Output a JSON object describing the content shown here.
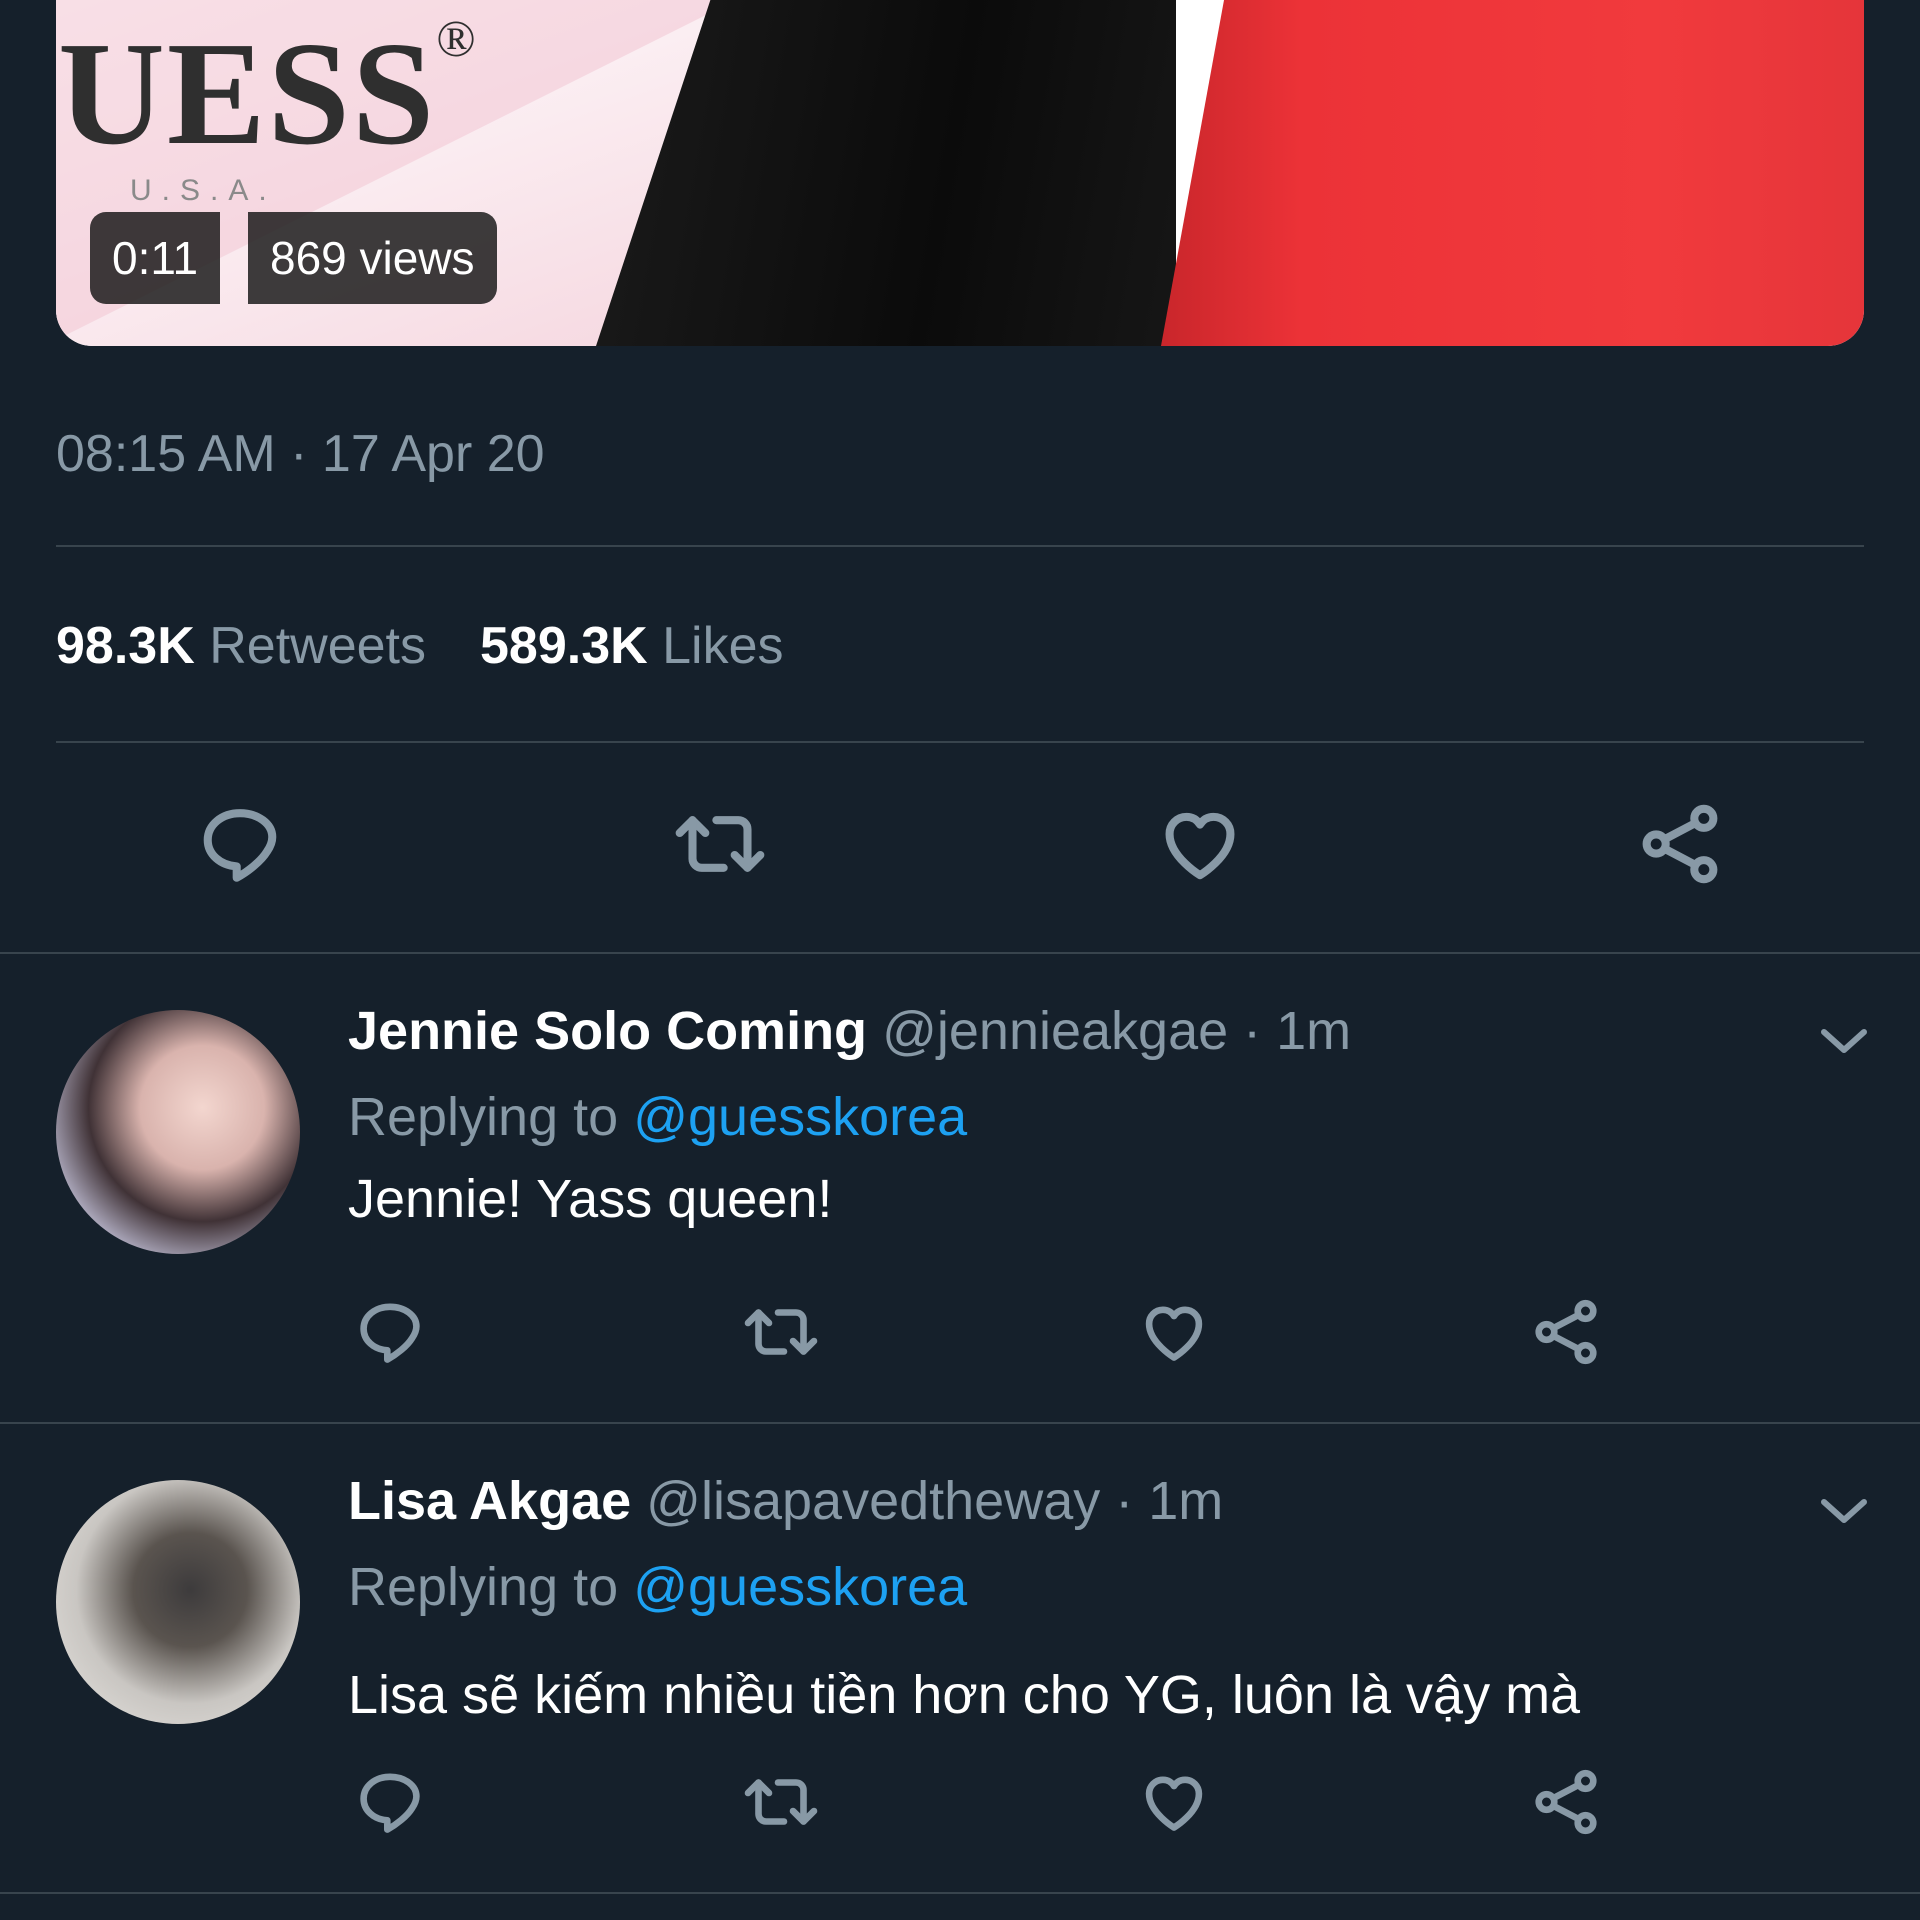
{
  "media": {
    "brand_text": "UESS",
    "brand_mark": "®",
    "brand_subtext": "U.S.A.",
    "duration": "0:11",
    "views": "869 views"
  },
  "tweet": {
    "timestamp": "08:15 AM · 17 Apr 20",
    "retweets_count": "98.3K",
    "retweets_label": "Retweets",
    "likes_count": "589.3K",
    "likes_label": "Likes"
  },
  "actions": {
    "icons": [
      "reply-icon",
      "retweet-icon",
      "like-icon",
      "share-icon"
    ]
  },
  "replies": [
    {
      "display_name": "Jennie Solo Coming",
      "handle": "@jennieakgae",
      "time": "· 1m",
      "replying_prefix": "Replying to",
      "replying_to": "@guesskorea",
      "text": "Jennie! Yass queen!"
    },
    {
      "display_name": "Lisa Akgae",
      "handle": "@lisapavedtheway",
      "time": "· 1m",
      "replying_prefix": "Replying to",
      "replying_to": "@guesskorea",
      "text": "Lisa sẽ kiếm nhiều tiền hơn cho YG, luôn là vậy mà"
    }
  ],
  "colors": {
    "background": "#15202b",
    "secondary_text": "#8899a6",
    "accent": "#1da1f2",
    "divider": "#38444d"
  }
}
